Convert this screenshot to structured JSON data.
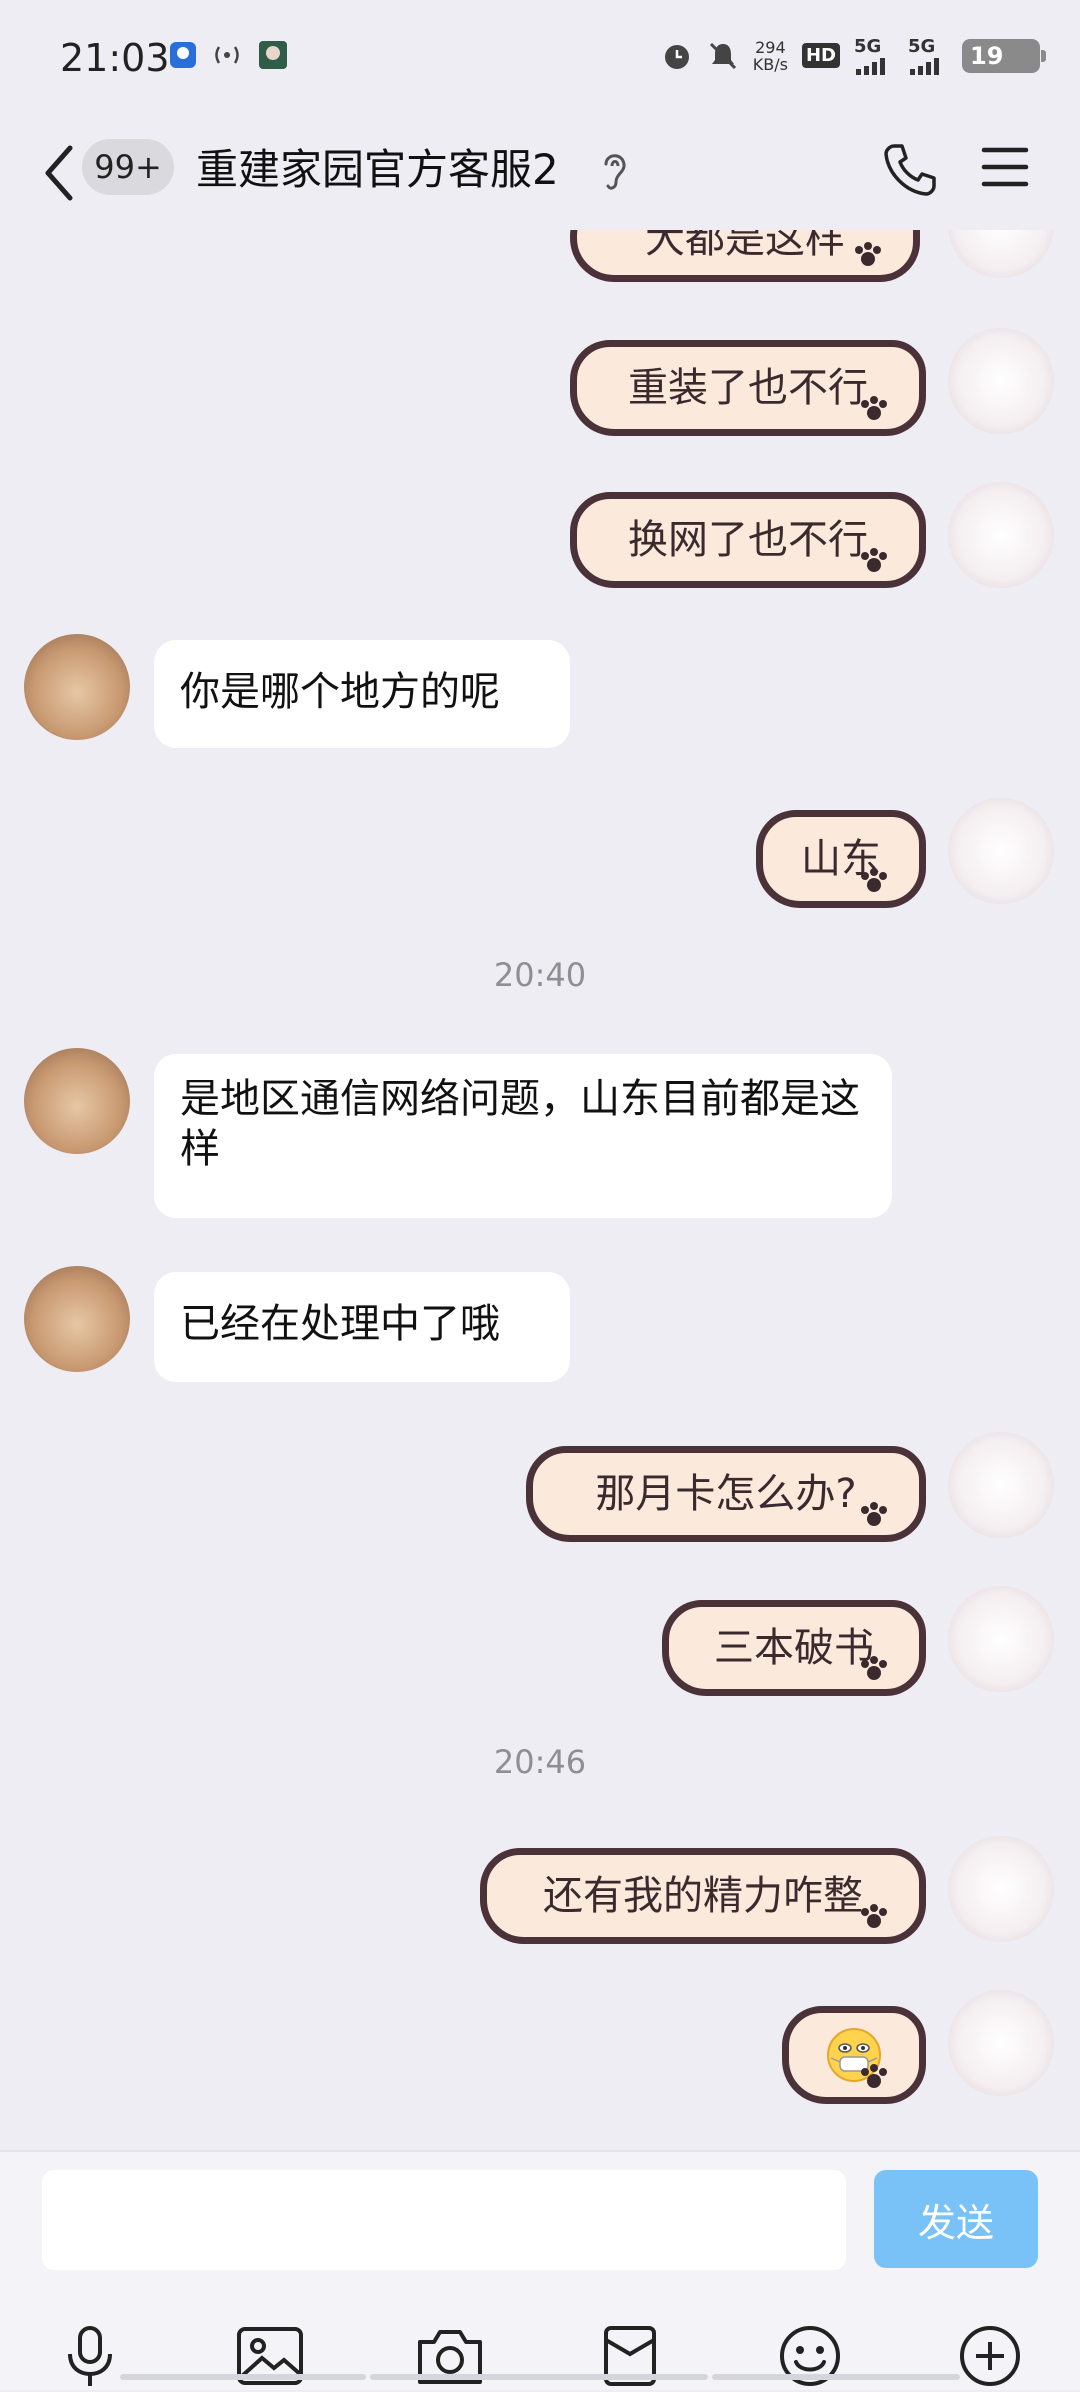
{
  "status_bar": {
    "time": "21:03",
    "speed_value": "294",
    "speed_unit": "KB/s",
    "hd": "HD",
    "sim1": "5G",
    "sim2": "5G",
    "battery": "19"
  },
  "header": {
    "unread_badge": "99+",
    "title": "重建家园官方客服2"
  },
  "messages": [
    {
      "side": "right",
      "text": "大都是这样"
    },
    {
      "side": "right",
      "text": "重装了也不行"
    },
    {
      "side": "right",
      "text": "换网了也不行"
    },
    {
      "side": "left",
      "text": "你是哪个地方的呢"
    },
    {
      "side": "right",
      "text": "山东"
    },
    {
      "side": "time",
      "text": "20:40"
    },
    {
      "side": "left",
      "text": "是地区通信网络问题，山东目前都是这样"
    },
    {
      "side": "left",
      "text": "已经在处理中了哦"
    },
    {
      "side": "right",
      "text": "那月卡怎么办?"
    },
    {
      "side": "right",
      "text": "三本破书"
    },
    {
      "side": "time",
      "text": "20:46"
    },
    {
      "side": "right",
      "text": "还有我的精力咋整"
    },
    {
      "side": "right",
      "emoji": "face-with-mask-emoji"
    }
  ],
  "input": {
    "placeholder": "",
    "send_label": "发送"
  },
  "toolbar": [
    "mic-icon",
    "image-icon",
    "camera-icon",
    "red-packet-icon",
    "emoji-icon",
    "plus-icon"
  ],
  "colors": {
    "background": "#EDEDF3",
    "send_button": "#79C2F7",
    "bubble_right_fill": "#FBE9DC",
    "bubble_right_border": "#4A3238"
  }
}
